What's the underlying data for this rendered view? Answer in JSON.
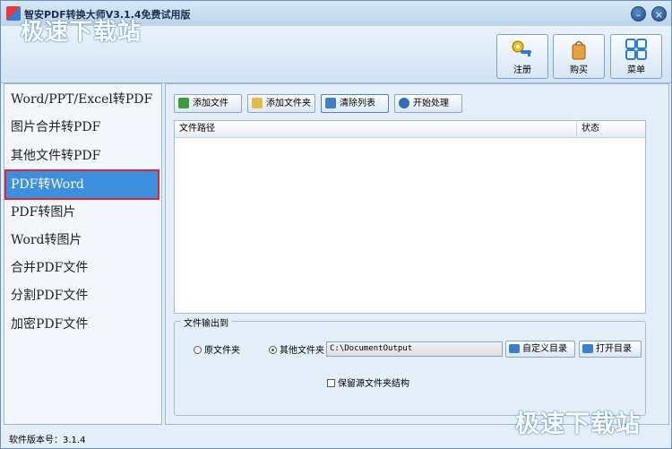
{
  "title_bar": {
    "title": "智安PDF转换大师V3.1.4免费试用版",
    "minimize_label": "–",
    "close_label": "×"
  },
  "watermark": {
    "text": "极速下载站"
  },
  "header": {
    "register_label": "注册",
    "buy_label": "购买",
    "menu_label": "菜单"
  },
  "sidebar": {
    "items": [
      {
        "label": "Word/PPT/Excel转PDF"
      },
      {
        "label": "图片合并转PDF"
      },
      {
        "label": "其他文件转PDF"
      },
      {
        "label": "PDF转Word",
        "active": true
      },
      {
        "label": "PDF转图片"
      },
      {
        "label": "Word转图片"
      },
      {
        "label": "合并PDF文件"
      },
      {
        "label": "分割PDF文件"
      },
      {
        "label": "加密PDF文件"
      }
    ]
  },
  "toolbar": {
    "add_file": "添加文件",
    "add_folder": "添加文件夹",
    "clear_list": "清除列表",
    "start": "开始处理"
  },
  "file_table": {
    "columns": [
      "文件路径",
      "状态"
    ],
    "rows": []
  },
  "output": {
    "legend": "文件输出到",
    "option_source": "原文件夹",
    "option_other": "其他文件夹",
    "path_value": "C:\\DocumentOutput",
    "custom_dir_button": "自定义目录",
    "open_dir_button": "打开目录",
    "keep_structure": "保留源文件夹结构"
  },
  "status": {
    "version_text": "软件版本号：3.1.4"
  },
  "colors": {
    "accent": "#3d8fe0",
    "highlight": "#e0262e"
  }
}
